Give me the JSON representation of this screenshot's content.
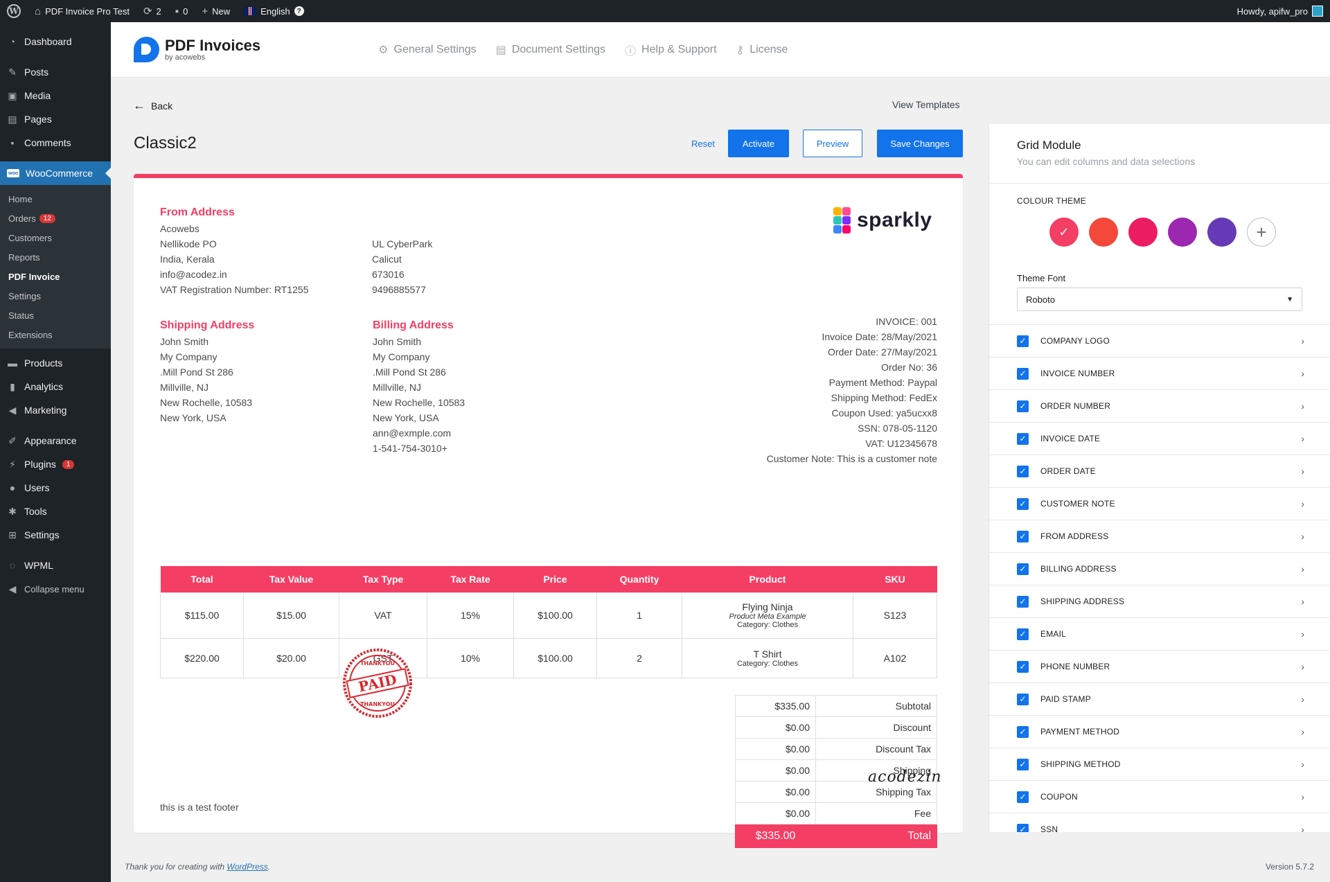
{
  "adminbar": {
    "site_name": "PDF Invoice Pro Test",
    "updates_count": "2",
    "comments_count": "0",
    "new_label": "New",
    "language": "English",
    "howdy": "Howdy, apifw_pro"
  },
  "sidebar": {
    "dashboard": "Dashboard",
    "posts": "Posts",
    "media": "Media",
    "pages": "Pages",
    "comments": "Comments",
    "woocommerce": "WooCommerce",
    "woo_icon_text": "woo",
    "sub": {
      "home": "Home",
      "orders": "Orders",
      "orders_badge": "12",
      "customers": "Customers",
      "reports": "Reports",
      "pdf_invoice": "PDF Invoice",
      "settings": "Settings",
      "status": "Status",
      "extensions": "Extensions"
    },
    "products": "Products",
    "analytics": "Analytics",
    "marketing": "Marketing",
    "appearance": "Appearance",
    "plugins": "Plugins",
    "plugins_badge": "1",
    "users": "Users",
    "tools": "Tools",
    "settings": "Settings",
    "wpml": "WPML",
    "collapse": "Collapse menu"
  },
  "plugin_header": {
    "title": "PDF Invoices",
    "subtitle": "by acowebs",
    "nav": {
      "general": "General Settings",
      "document": "Document Settings",
      "help": "Help & Support",
      "license": "License"
    }
  },
  "main": {
    "back": "Back",
    "view_templates": "View Templates",
    "template_name": "Classic2",
    "reset": "Reset",
    "activate": "Activate",
    "preview": "Preview",
    "save": "Save Changes"
  },
  "invoice": {
    "from_heading": "From Address",
    "from_lines": [
      "Acowebs",
      "Nellikode PO",
      "India, Kerala",
      "info@acodez.in",
      "VAT Registration Number: RT1255"
    ],
    "from_lines_2": [
      "UL CyberPark",
      "Calicut",
      "673016",
      "9496885577"
    ],
    "logo_text": "sparkly",
    "shipping_heading": "Shipping Address",
    "shipping_lines": [
      "John Smith",
      "My Company",
      ".Mill Pond St 286",
      "Millville, NJ",
      "New Rochelle, 10583",
      "New York, USA"
    ],
    "billing_heading": "Billing Address",
    "billing_lines": [
      "John Smith",
      "My Company",
      ".Mill Pond St 286",
      "Millville, NJ",
      "New Rochelle, 10583",
      "New York, USA",
      "ann@exmple.com",
      "1-541-754-3010+"
    ],
    "meta_lines": [
      "INVOICE: 001",
      "Invoice Date: 28/May/2021",
      "Order Date: 27/May/2021",
      "Order No: 36",
      "Payment Method: Paypal",
      "Shipping Method: FedEx",
      "Coupon Used: ya5ucxx8",
      "SSN: 078-05-1120",
      "VAT: U12345678",
      "Customer Note: This is a customer note"
    ],
    "table": {
      "headers": [
        "Total",
        "Tax Value",
        "Tax Type",
        "Tax Rate",
        "Price",
        "Quantity",
        "Product",
        "SKU"
      ],
      "rows": [
        {
          "total": "$115.00",
          "tax_value": "$15.00",
          "tax_type": "VAT",
          "tax_rate": "15%",
          "price": "$100.00",
          "quantity": "1",
          "product": "Flying Ninja",
          "meta": "Product Meta Example",
          "category": "Category: Clothes",
          "sku": "S123"
        },
        {
          "total": "$220.00",
          "tax_value": "$20.00",
          "tax_type": "GST",
          "tax_rate": "10%",
          "price": "$100.00",
          "quantity": "2",
          "product": "T Shirt",
          "meta": "",
          "category": "Category: Clothes",
          "sku": "A102"
        }
      ]
    },
    "totals": [
      {
        "value": "$335.00",
        "label": "Subtotal"
      },
      {
        "value": "$0.00",
        "label": "Discount"
      },
      {
        "value": "$0.00",
        "label": "Discount Tax"
      },
      {
        "value": "$0.00",
        "label": "Shipping"
      },
      {
        "value": "$0.00",
        "label": "Shipping Tax"
      },
      {
        "value": "$0.00",
        "label": "Fee"
      }
    ],
    "grand_total": {
      "value": "$335.00",
      "label": "Total"
    },
    "stamp_main": "PAID",
    "stamp_ring": "THANKYOU",
    "signature": "acodezin",
    "footer": "this is a test footer"
  },
  "panel": {
    "title": "Grid Module",
    "subtitle": "You can edit columns and data selections",
    "colour_label": "COLOUR THEME",
    "colours": [
      "#f43e64",
      "#f4483a",
      "#ec1c63",
      "#9c27b0",
      "#673ab7"
    ],
    "selected_colour": 0,
    "font_label": "Theme Font",
    "font_value": "Roboto",
    "options": [
      "COMPANY LOGO",
      "INVOICE NUMBER",
      "ORDER NUMBER",
      "INVOICE DATE",
      "ORDER DATE",
      "CUSTOMER NOTE",
      "FROM ADDRESS",
      "BILLING ADDRESS",
      "SHIPPING ADDRESS",
      "EMAIL",
      "PHONE NUMBER",
      "PAID STAMP",
      "PAYMENT METHOD",
      "SHIPPING METHOD",
      "COUPON",
      "SSN"
    ]
  },
  "footer": {
    "thanks_prefix": "Thank you for creating with ",
    "thanks_link": "WordPress",
    "thanks_suffix": ".",
    "version": "Version 5.7.2"
  },
  "colors": {
    "accent": "#f43e64",
    "primary": "#1273eb",
    "admin_dark": "#1d2327"
  }
}
